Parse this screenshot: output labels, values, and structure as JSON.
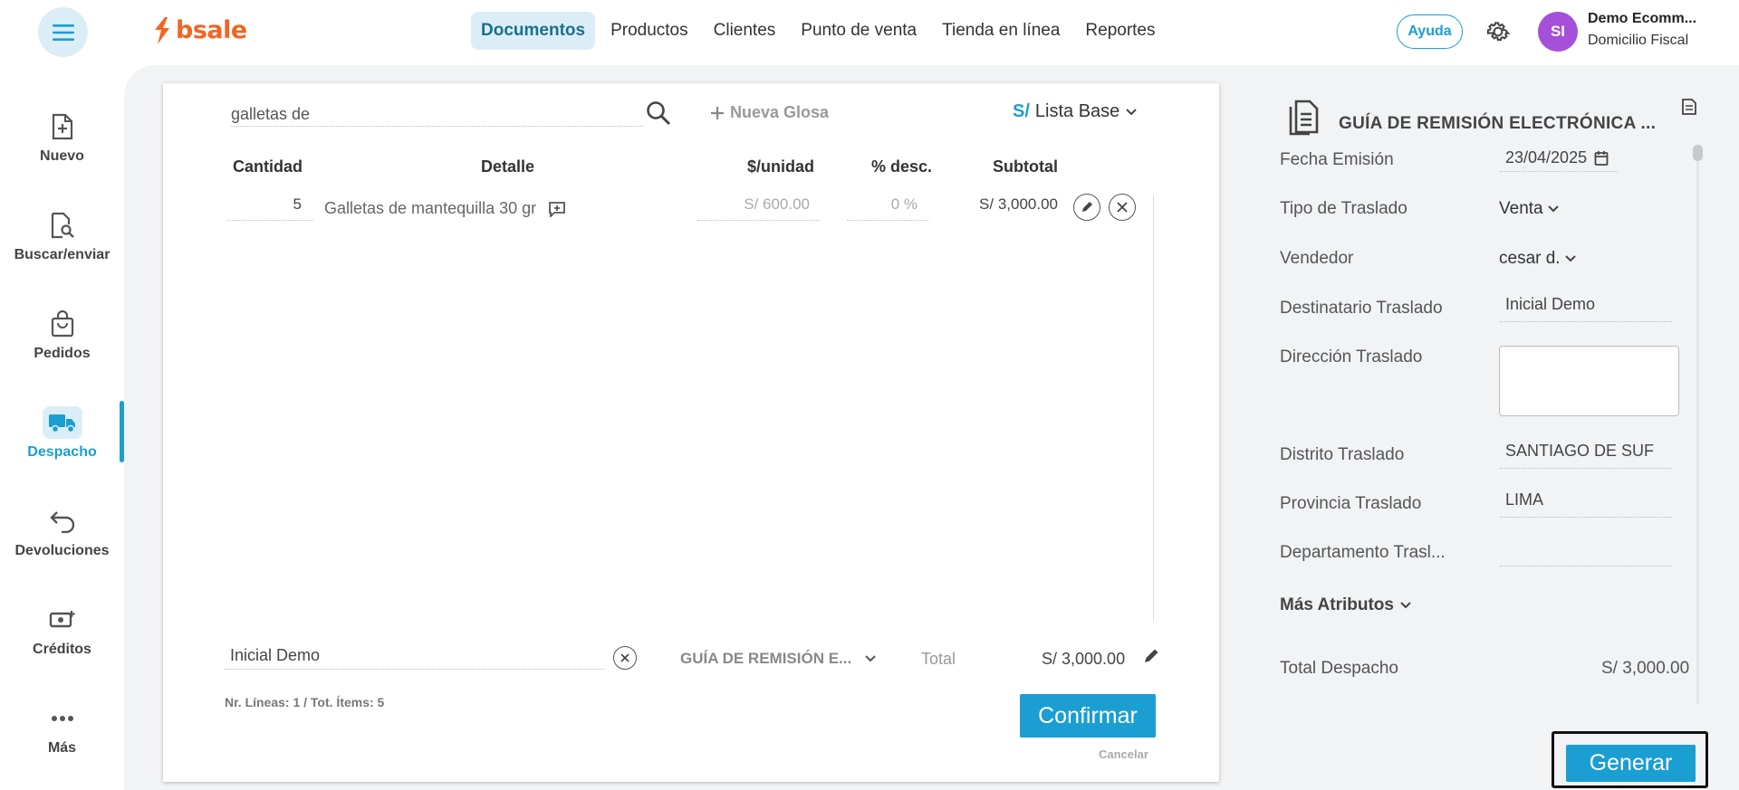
{
  "header": {
    "brand": "bsale",
    "nav": [
      "Documentos",
      "Productos",
      "Clientes",
      "Punto de venta",
      "Tienda en línea",
      "Reportes"
    ],
    "help_label": "Ayuda",
    "avatar_initials": "SI",
    "user_name": "Demo Ecomm...",
    "user_sub": "Domicilio Fiscal",
    "accent_color": "#1b9ed2",
    "brand_color": "#f26522"
  },
  "sidebar": {
    "items": [
      {
        "label": "Nuevo",
        "icon": "file-plus-icon"
      },
      {
        "label": "Buscar/enviar",
        "icon": "file-search-icon"
      },
      {
        "label": "Pedidos",
        "icon": "shopping-bag-icon"
      },
      {
        "label": "Despacho",
        "icon": "truck-icon",
        "active": true
      },
      {
        "label": "Devoluciones",
        "icon": "return-arrow-icon"
      },
      {
        "label": "Créditos",
        "icon": "cash-plus-icon"
      },
      {
        "label": "Más",
        "icon": "more-dots-icon"
      }
    ]
  },
  "document": {
    "search_value": "galletas de",
    "new_gloss_label": "Nueva Glosa",
    "currency_symbol": "S/",
    "price_list": "Lista Base",
    "columns": [
      "Cantidad",
      "Detalle",
      "$/unidad",
      "% desc.",
      "Subtotal"
    ],
    "rows": [
      {
        "qty": "5",
        "detail": "Galletas de mantequilla 30 gr",
        "unit_price": "S/ 600.00",
        "discount": "0 %",
        "subtotal": "S/ 3,000.00"
      }
    ],
    "client": "Inicial Demo",
    "doc_type": "GUÍA DE REMISIÓN E...",
    "total_label": "Total",
    "total_value": "S/ 3,000.00",
    "lines_info": "Nr. Líneas: 1 / Tot. Ítems: 5",
    "confirm_label": "Confirmar",
    "cancel_label": "Cancelar"
  },
  "panel": {
    "title": "GUÍA DE REMISIÓN ELECTRÓNICA ...",
    "fields": {
      "fecha_label": "Fecha Emisión",
      "fecha_value": "23/04/2025",
      "tipo_label": "Tipo de Traslado",
      "tipo_value": "Venta",
      "vendedor_label": "Vendedor",
      "vendedor_value": "cesar d.",
      "destinatario_label": "Destinatario Traslado",
      "destinatario_value": "Inicial Demo",
      "direccion_label": "Dirección Traslado",
      "distrito_label": "Distrito Traslado",
      "distrito_value": "SANTIAGO DE SUF",
      "provincia_label": "Provincia Traslado",
      "provincia_value": "LIMA",
      "departamento_label": "Departamento Trasl..."
    },
    "more_attrs_label": "Más Atributos",
    "total_label": "Total Despacho",
    "total_value": "S/ 3,000.00",
    "generate_label": "Generar"
  }
}
